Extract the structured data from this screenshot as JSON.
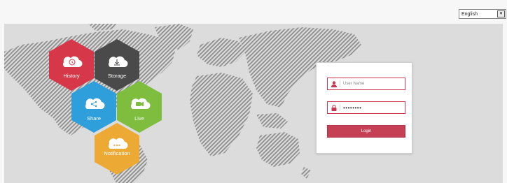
{
  "language": {
    "selected": "English"
  },
  "colors": {
    "history": "#d63749",
    "storage": "#4a4a4a",
    "share": "#2e9fdb",
    "live": "#7ebd3d",
    "notification": "#ecaa35",
    "accent": "#c54055"
  },
  "features": [
    {
      "key": "history",
      "label": "History",
      "icon": "clock-icon"
    },
    {
      "key": "storage",
      "label": "Storage",
      "icon": "download-icon"
    },
    {
      "key": "share",
      "label": "Share",
      "icon": "share-icon"
    },
    {
      "key": "live",
      "label": "Live",
      "icon": "video-camera-icon"
    },
    {
      "key": "notification",
      "label": "Notification",
      "icon": "ellipsis-icon"
    }
  ],
  "login": {
    "username_placeholder": "User Name",
    "password_mask": "••••••••",
    "button_label": "Login"
  }
}
